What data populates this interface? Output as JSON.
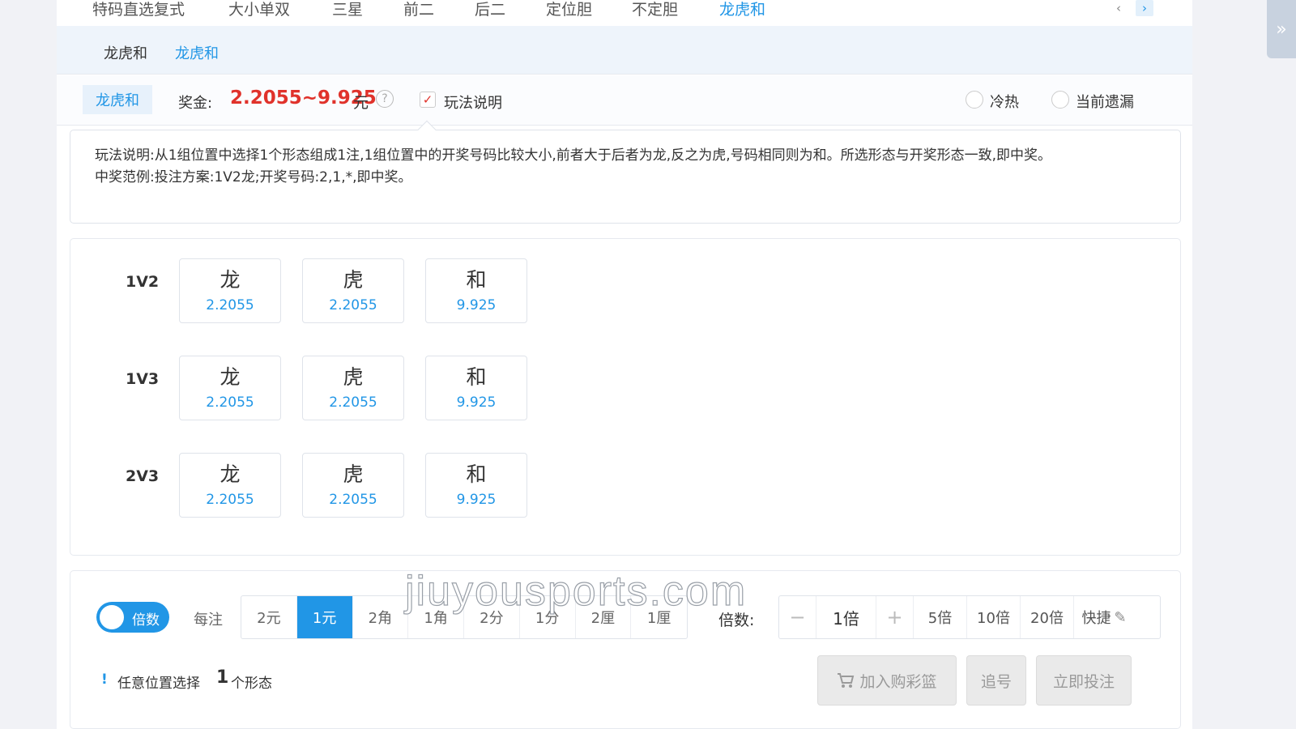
{
  "top_tabs": [
    "特码直选复式",
    "大小单双",
    "三星",
    "前二",
    "后二",
    "定位胆",
    "不定胆",
    "龙虎和"
  ],
  "top_tabs_active": 7,
  "nav_arrows": {
    "prev": "‹",
    "next": "›"
  },
  "sub_tabs": [
    "龙虎和",
    "龙虎和"
  ],
  "bonus": {
    "play_name": "龙虎和",
    "label": "奖金:",
    "value": "2.2055~9.925",
    "unit": "元",
    "help": "?",
    "rules_checkbox_label": "玩法说明",
    "rules_checked": true,
    "check_mark": "✓",
    "radio_hot_cold": "冷热",
    "radio_missing": "当前遗漏"
  },
  "description": {
    "line1": "玩法说明:从1组位置中选择1个形态组成1注,1组位置中的开奖号码比较大小,前者大于后者为龙,反之为虎,号码相同则为和。所选形态与开奖形态一致,即中奖。",
    "line2": "中奖范例:投注方案:1V2龙;开奖号码:2,1,*,即中奖。"
  },
  "bet_rows": [
    {
      "label": "1V2",
      "cells": [
        {
          "name": "龙",
          "odds": "2.2055"
        },
        {
          "name": "虎",
          "odds": "2.2055"
        },
        {
          "name": "和",
          "odds": "9.925"
        }
      ]
    },
    {
      "label": "1V3",
      "cells": [
        {
          "name": "龙",
          "odds": "2.2055"
        },
        {
          "name": "虎",
          "odds": "2.2055"
        },
        {
          "name": "和",
          "odds": "9.925"
        }
      ]
    },
    {
      "label": "2V3",
      "cells": [
        {
          "name": "龙",
          "odds": "2.2055"
        },
        {
          "name": "虎",
          "odds": "2.2055"
        },
        {
          "name": "和",
          "odds": "9.925"
        }
      ]
    }
  ],
  "bet_bar": {
    "toggle_label": "倍数",
    "toggle_on": true,
    "per_bet_label": "每注",
    "units": [
      "2元",
      "1元",
      "2角",
      "1角",
      "2分",
      "1分",
      "2厘",
      "1厘"
    ],
    "unit_active": 1,
    "multiplier_label": "倍数:",
    "minus": "−",
    "multiplier_value": "1倍",
    "plus": "+",
    "presets": [
      "5倍",
      "10倍",
      "20倍"
    ],
    "quick_label": "快捷",
    "quick_icon": "✎",
    "info_icon": "!",
    "info_prefix": "任意位置选择",
    "info_count": "1",
    "info_suffix": "个形态",
    "add_to_cart": "加入购彩篮",
    "chase": "追号",
    "bet_now": "立即投注"
  },
  "watermark": "jiuyousports.com",
  "side_toggle": "»",
  "colors": {
    "accent": "#2196e6",
    "bonus_red": "#e0322b",
    "disabled_gray": "#9a9a9a"
  }
}
